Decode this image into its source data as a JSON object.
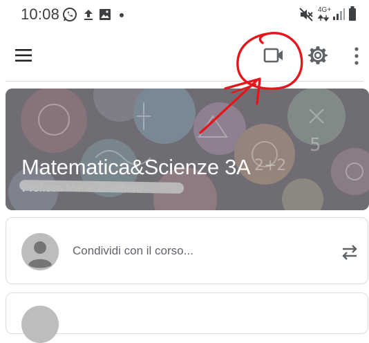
{
  "status_bar": {
    "time": "10:08",
    "network_label": "4G+"
  },
  "app_bar": {
    "menu_icon": "hamburger-menu-icon",
    "meet_icon": "video-camera-icon",
    "settings_icon": "gear-icon",
    "more_icon": "more-vert-icon"
  },
  "class_banner": {
    "title": "Matematica&Scienze 3A",
    "subtitle": "Prof.ssa Maria Zucchero"
  },
  "share_card": {
    "placeholder": "Condividi con il corso...",
    "repost_icon": "repost-icon"
  },
  "colors": {
    "annotation_red": "#e5161b",
    "divider": "#dadce0",
    "icon_gray": "#5f6368"
  }
}
